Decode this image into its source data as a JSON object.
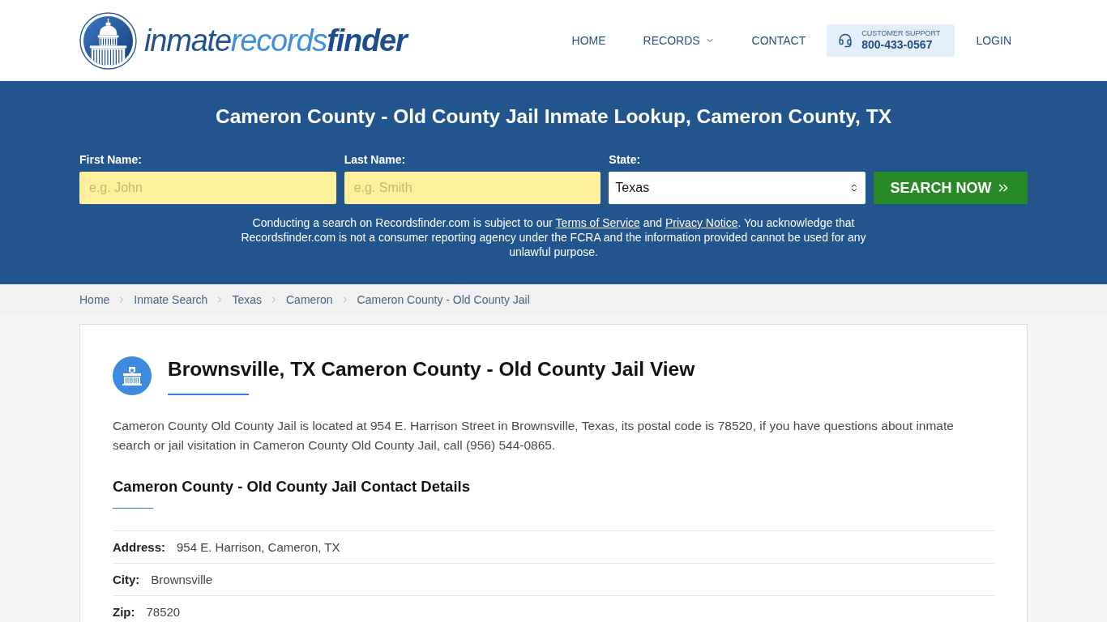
{
  "header": {
    "logo": {
      "wordmark": [
        {
          "kind": "plain",
          "text": "inmate"
        },
        {
          "kind": "accent",
          "text": "records"
        },
        {
          "kind": "bold",
          "text": "finder"
        }
      ]
    },
    "nav": [
      {
        "kind": "link",
        "label": "HOME"
      },
      {
        "kind": "dropdown",
        "label": "RECORDS"
      },
      {
        "kind": "link",
        "label": "CONTACT"
      }
    ],
    "support": {
      "caption": "CUSTOMER SUPPORT",
      "phone": "800-433-0567"
    },
    "login": "LOGIN"
  },
  "search": {
    "title": "Cameron County - Old County Jail Inmate Lookup, Cameron County, TX",
    "fields": [
      {
        "kind": "text",
        "label": "First Name:",
        "placeholder": "e.g. John"
      },
      {
        "kind": "text",
        "label": "Last Name:",
        "placeholder": "e.g. Smith"
      },
      {
        "kind": "select",
        "label": "State:",
        "value": "Texas"
      }
    ],
    "button": "SEARCH NOW",
    "disclaimer": [
      {
        "kind": "text",
        "text": "Conducting a search on Recordsfinder.com is subject to our "
      },
      {
        "kind": "link",
        "text": "Terms of Service"
      },
      {
        "kind": "text",
        "text": " and "
      },
      {
        "kind": "link",
        "text": "Privacy Notice"
      },
      {
        "kind": "text",
        "text": ". You acknowledge that Recordsfinder.com is not a consumer reporting agency under the FCRA and the information provided cannot be used for any unlawful purpose."
      }
    ]
  },
  "breadcrumb": [
    "Home",
    "Inmate Search",
    "Texas",
    "Cameron",
    "Cameron County - Old County Jail"
  ],
  "facility": {
    "heading": "Brownsville, TX Cameron County - Old County Jail View",
    "description": "Cameron County Old County Jail is located at 954 E. Harrison Street in Brownsville, Texas, its postal code is 78520, if you have questions about inmate search or jail visitation in Cameron County Old County Jail, call (956) 544-0865.",
    "contact_heading": "Cameron County - Old County Jail Contact Details",
    "details": [
      {
        "label": "Address:",
        "value": "954 E. Harrison, Cameron, TX"
      },
      {
        "label": "City:",
        "value": "Brownsville"
      },
      {
        "label": "Zip:",
        "value": "78520"
      }
    ]
  }
}
